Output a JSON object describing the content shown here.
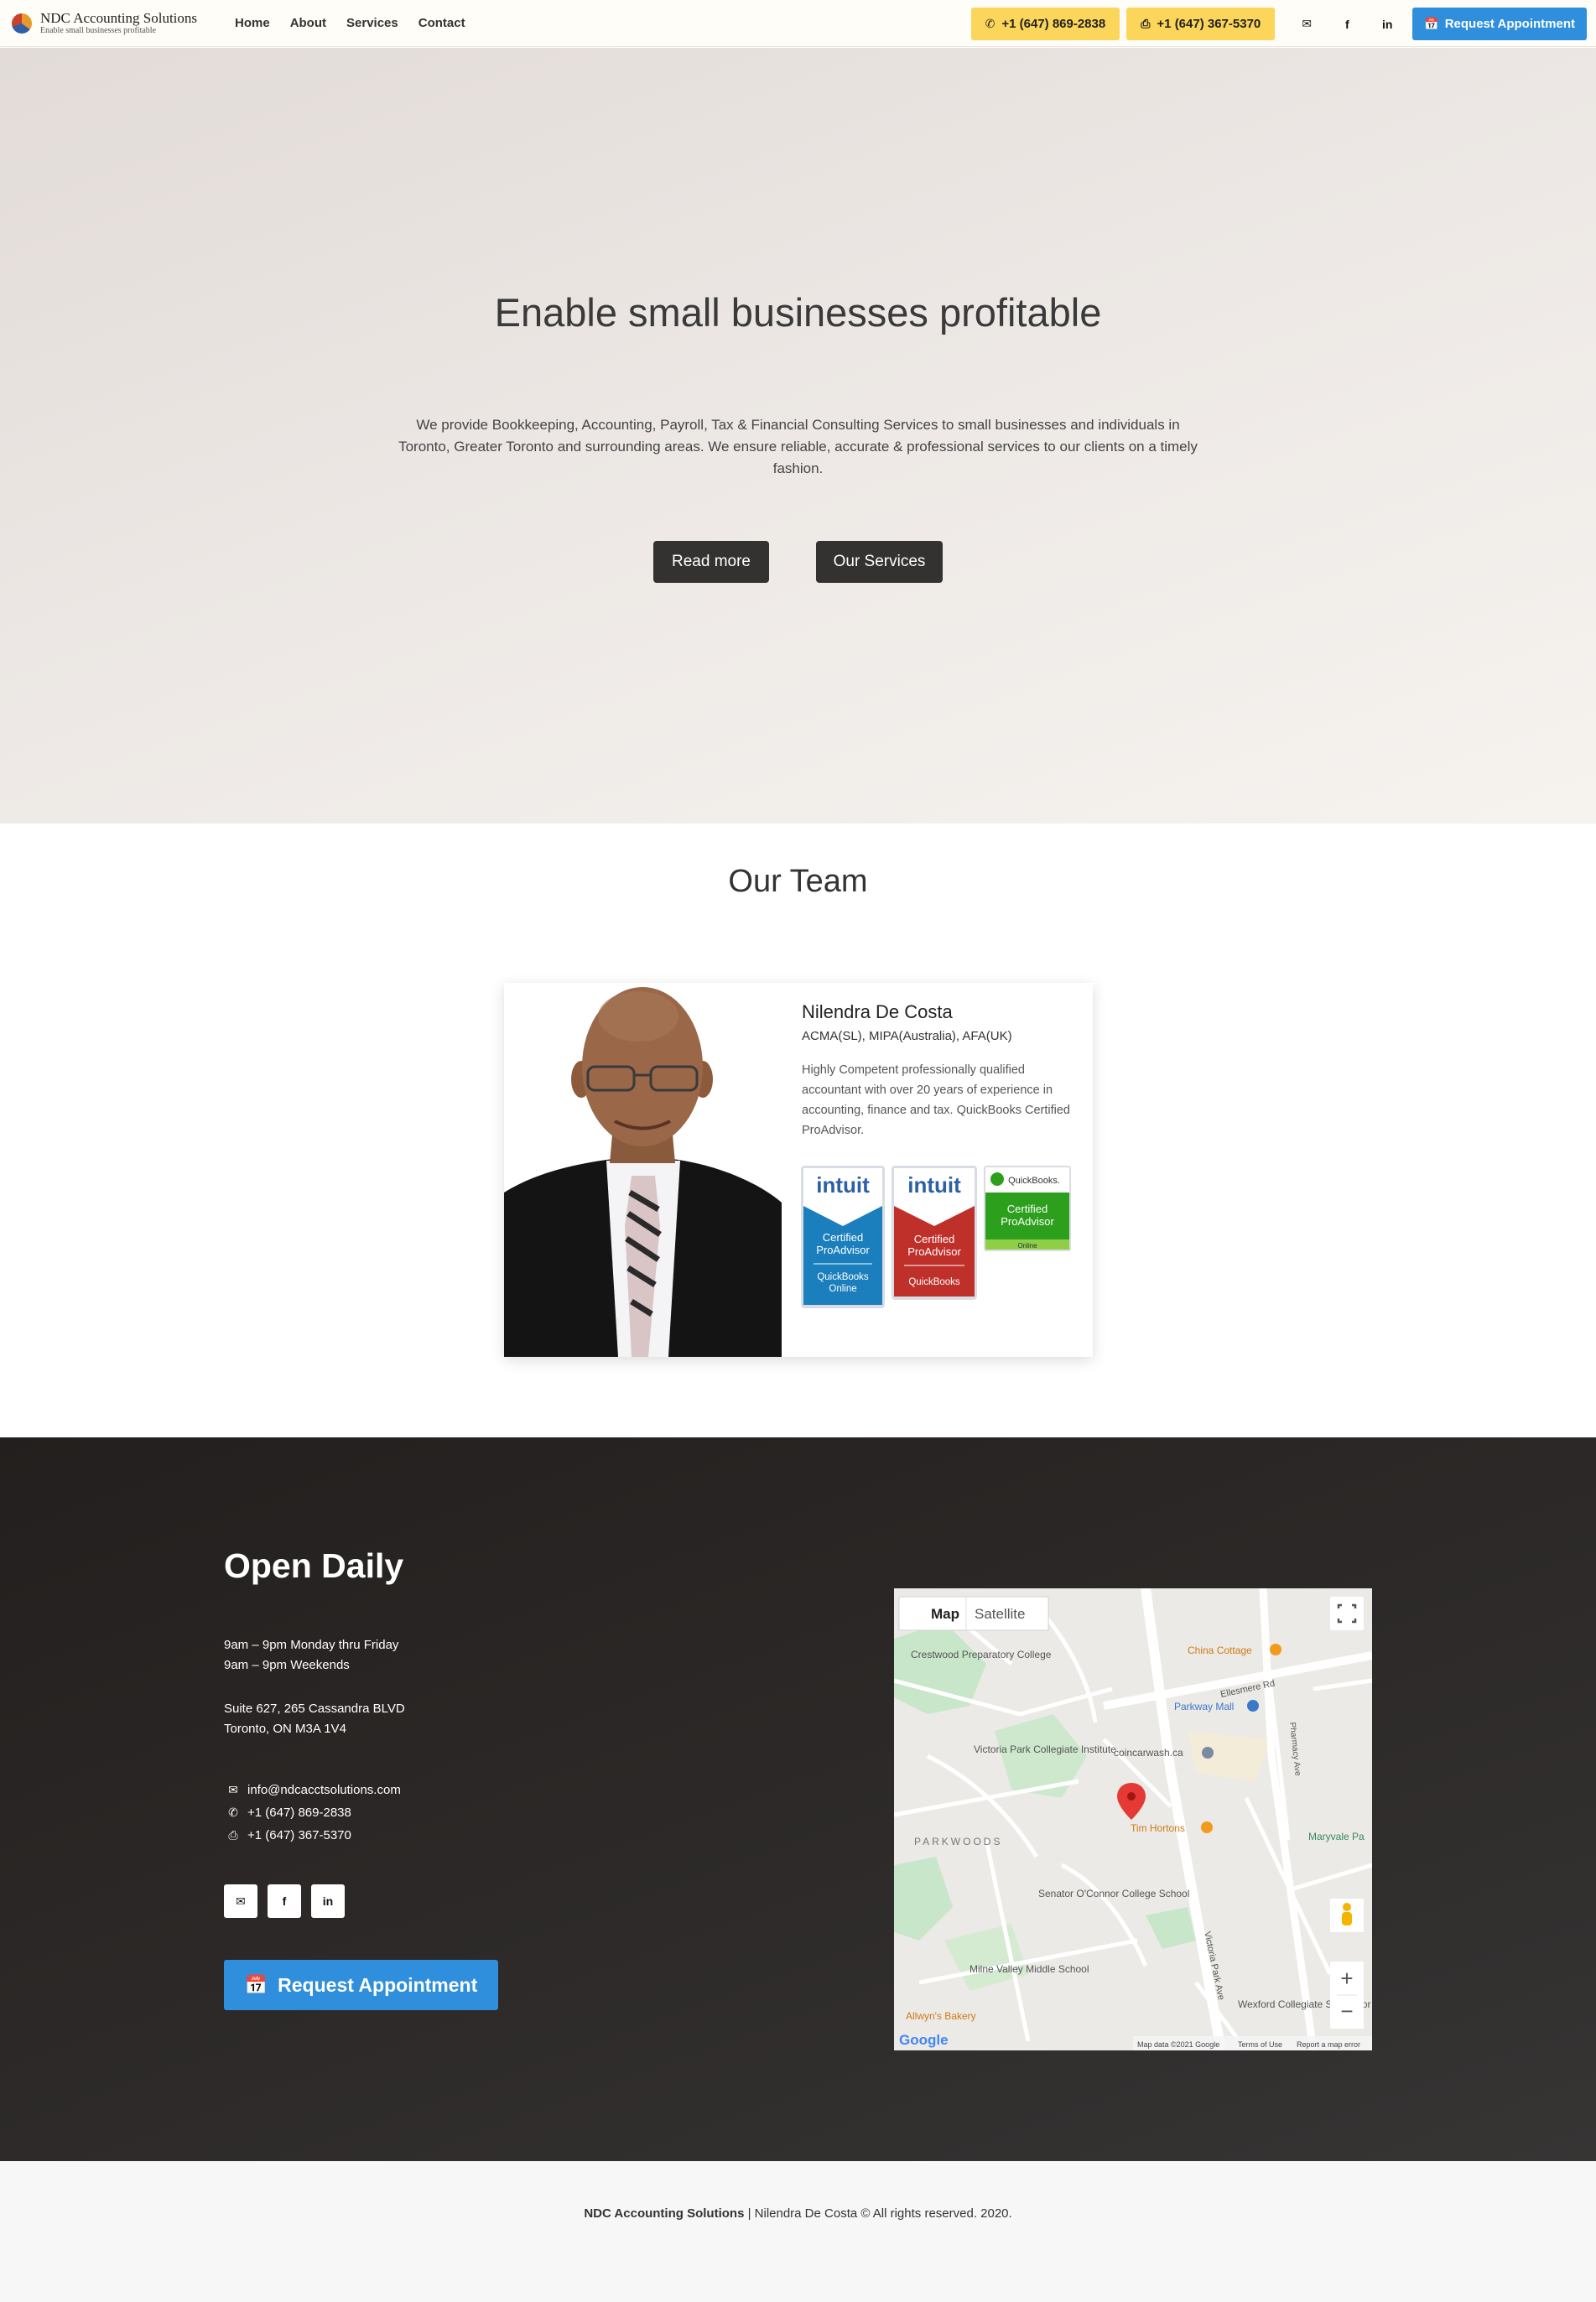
{
  "nav": {
    "brand_name": "NDC Accounting Solutions",
    "brand_tagline": "Enable small businesses profitable",
    "links": [
      "Home",
      "About",
      "Services",
      "Contact"
    ],
    "phone1": "+1 (647) 869-2838",
    "phone2": "+1 (647) 367-5370",
    "appointment_label": "Request Appointment"
  },
  "hero": {
    "title": "Enable small businesses profitable",
    "text": "We provide Bookkeeping, Accounting, Payroll, Tax & Financial Consulting Services to small businesses and individuals in Toronto, Greater Toronto and surrounding areas. We ensure reliable, accurate & professional services to our clients on a timely fashion.",
    "btn_read_more": "Read more",
    "btn_services": "Our Services"
  },
  "team": {
    "title": "Our Team",
    "member": {
      "name": "Nilendra De Costa",
      "credentials": "ACMA(SL), MIPA(Australia), AFA(UK)",
      "description": "Highly Competent professionally qualified accountant with over 20 years of experience in accounting, finance and tax. QuickBooks Certified ProAdvisor."
    },
    "badges": {
      "b1_brand": "intuit",
      "b1_cert": "Certified",
      "b1_pro": "ProAdvisor",
      "b1_prod1": "QuickBooks",
      "b1_prod2": "Online",
      "b2_brand": "intuit",
      "b2_cert": "Certified",
      "b2_pro": "ProAdvisor",
      "b2_prod": "QuickBooks",
      "b3_brand": "QuickBooks.",
      "b3_cert": "Certified",
      "b3_pro": "ProAdvisor",
      "b3_prod": "Online"
    }
  },
  "contact": {
    "title": "Open Daily",
    "hours_line1": "9am – 9pm Monday thru Friday",
    "hours_line2": "9am – 9pm Weekends",
    "address_line1": "Suite 627, 265 Cassandra BLVD",
    "address_line2": "Toronto, ON M3A 1V4",
    "email": "info@ndcacctsolutions.com",
    "phone1": "+1 (647) 869-2838",
    "phone2": "+1 (647) 367-5370",
    "appointment_label": "Request Appointment"
  },
  "map": {
    "tab_map": "Map",
    "tab_satellite": "Satellite",
    "labels": {
      "china_cottage": "China Cottage",
      "ellesmere_rd": "Ellesmere Rd",
      "parkway_mall": "Parkway Mall",
      "victoria_park_collegiate": "Victoria Park Collegiate Institute",
      "coincarwash": "coincarwash.ca",
      "tim_hortons": "Tim Hortons",
      "parkwoods": "PARKWOODS",
      "senator_oconnor": "Senator O'Connor College School",
      "milne_valley": "Milne Valley Middle School",
      "allwyns": "Allwyn's Bakery",
      "wexford": "Wexford Collegiate School for the Arts",
      "maryvale": "Maryvale Pa",
      "crestwood": "Crestwood Preparatory College",
      "victoria_park_ave": "Victoria Park Ave",
      "pharmacy_ave": "Pharmacy Ave",
      "google": "Google",
      "attribution": "Map data ©2021 Google",
      "terms": "Terms of Use",
      "report": "Report a map error"
    }
  },
  "footer": {
    "company": "NDC Accounting Solutions",
    "rest": " | Nilendra De Costa © All rights reserved. 2020."
  },
  "colors": {
    "accent_blue": "#2f8fdc",
    "phone_yellow": "#fcd55b",
    "dark_button": "#333231",
    "dark_section": "#2d2a29"
  },
  "icons": [
    "phone-icon",
    "fax-icon",
    "envelope-icon",
    "facebook-icon",
    "linkedin-icon",
    "calendar-check-icon",
    "map-pin-icon",
    "fullscreen-icon",
    "pegman-icon",
    "zoom-in-icon",
    "zoom-out-icon"
  ]
}
